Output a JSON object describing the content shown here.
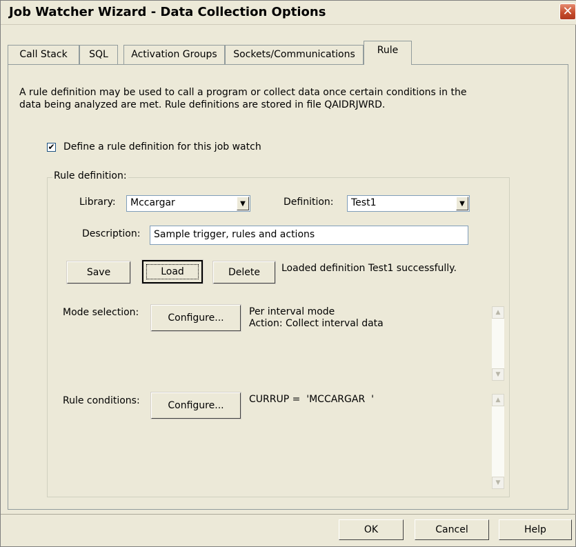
{
  "window": {
    "title": "Job Watcher Wizard - Data Collection Options",
    "close_glyph": "✕"
  },
  "tabs": [
    {
      "label": "Call Stack",
      "active": false
    },
    {
      "label": "SQL",
      "active": false
    },
    {
      "label": "Activation Groups",
      "active": false
    },
    {
      "label": "Sockets/Communications",
      "active": false
    },
    {
      "label": "Rule",
      "active": true
    }
  ],
  "rule_tab": {
    "intro_line1": "A rule definition may be used to call a program or collect data once certain conditions in the",
    "intro_line2": "data being analyzed are met.  Rule definitions are stored in file QAIDRJWRD.",
    "define_checkbox": {
      "label": "Define a rule definition for this job watch",
      "checked": true,
      "mark": "✔"
    },
    "group_label": "Rule definition:",
    "library": {
      "label": "Library:",
      "value": "Mccargar"
    },
    "definition": {
      "label": "Definition:",
      "value": "Test1"
    },
    "description": {
      "label": "Description:",
      "value": "Sample trigger, rules and actions"
    },
    "buttons": {
      "save": "Save",
      "load": "Load",
      "delete": "Delete"
    },
    "status_message": "Loaded definition Test1 successfully.",
    "mode_selection": {
      "label": "Mode selection:",
      "button": "Configure...",
      "line1": "Per interval mode",
      "line2": "Action: Collect interval data"
    },
    "rule_conditions": {
      "label": "Rule conditions:",
      "button": "Configure...",
      "text": "CURRUP =  'MCCARGAR  '"
    },
    "dropdown_glyph": "▼",
    "scroll_up_glyph": "▲",
    "scroll_down_glyph": "▼"
  },
  "footer": {
    "ok": "OK",
    "cancel": "Cancel",
    "help": "Help"
  },
  "icons": [
    "close-icon",
    "chevron-down-icon",
    "checkmark-icon",
    "scroll-up-icon",
    "scroll-down-icon"
  ]
}
